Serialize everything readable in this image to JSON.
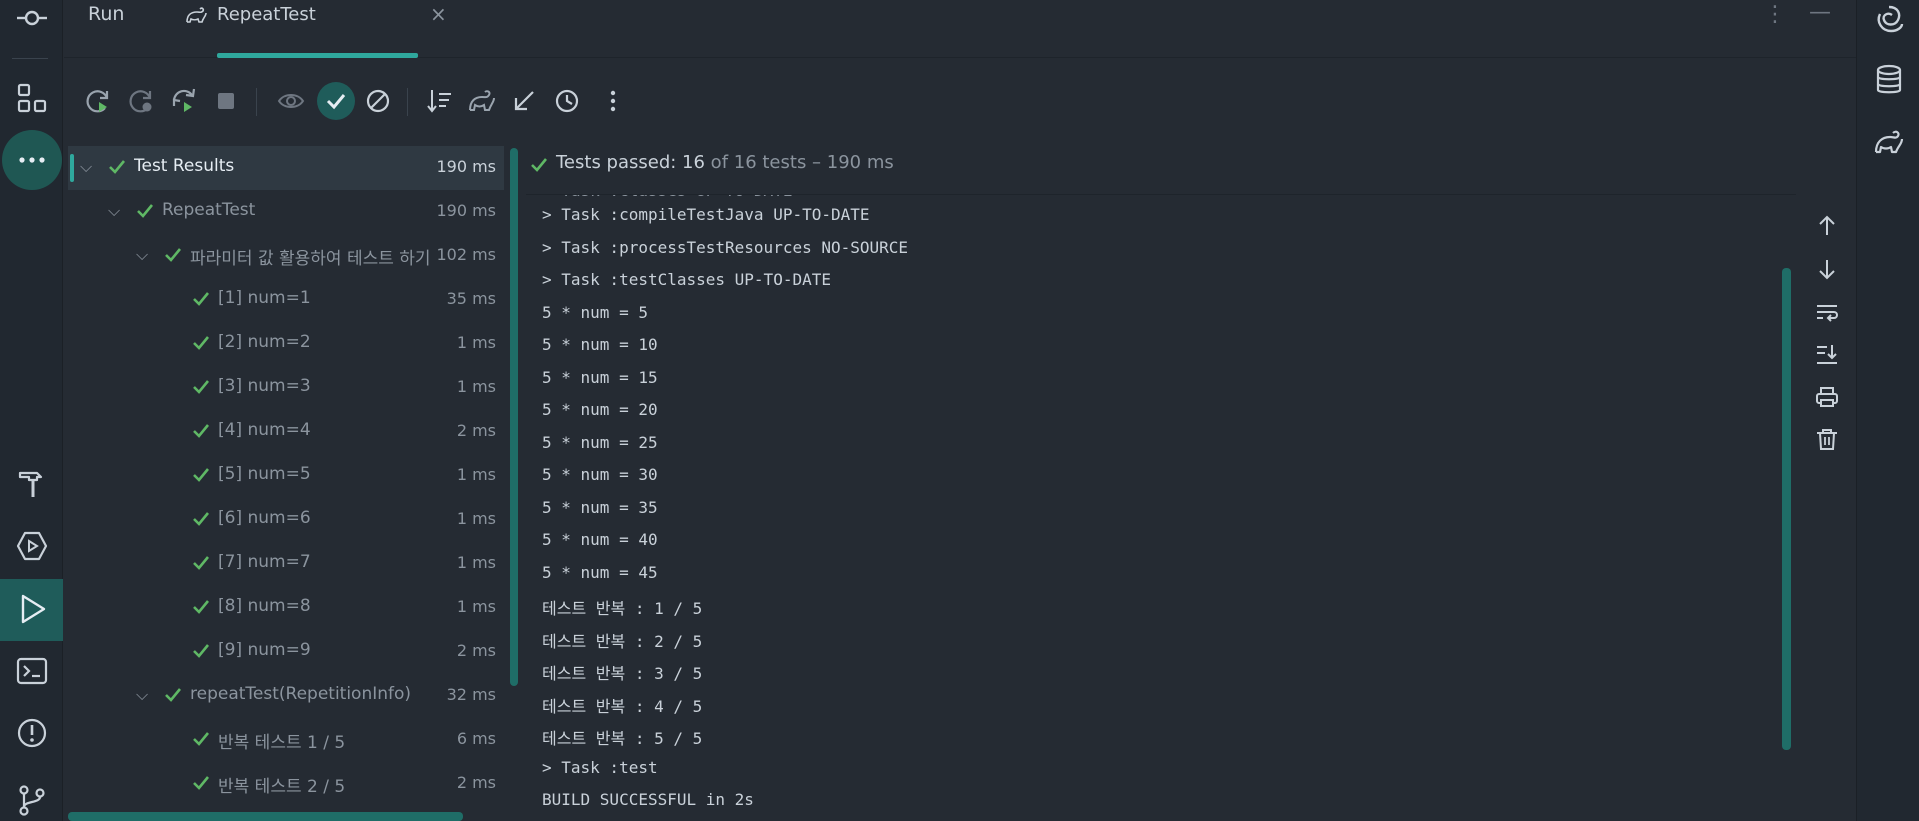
{
  "tabs": {
    "run_label": "Run",
    "repeat_label": "RepeatTest",
    "close_glyph": "×"
  },
  "toolbar": {
    "buttons": [
      "rerun-icon",
      "rerun-failed-icon",
      "toggle-auto-test-icon",
      "stop-icon",
      "show-ignored-icon",
      "show-passed-icon",
      "show-ignored-toggle-icon",
      "sort-icon",
      "import-tests-icon",
      "collapse-icon",
      "history-icon",
      "more-icon"
    ]
  },
  "tree": {
    "root": {
      "label": "Test Results",
      "time": "190 ms"
    },
    "repeat_class": {
      "label": "RepeatTest",
      "time": "190 ms"
    },
    "param_group": {
      "label": "파라미터 값 활용하여 테스트 하기",
      "time": "102 ms"
    },
    "param_items": [
      {
        "label": "[1] num=1",
        "time": "35 ms"
      },
      {
        "label": "[2] num=2",
        "time": "1 ms"
      },
      {
        "label": "[3] num=3",
        "time": "1 ms"
      },
      {
        "label": "[4] num=4",
        "time": "2 ms"
      },
      {
        "label": "[5] num=5",
        "time": "1 ms"
      },
      {
        "label": "[6] num=6",
        "time": "1 ms"
      },
      {
        "label": "[7] num=7",
        "time": "1 ms"
      },
      {
        "label": "[8] num=8",
        "time": "1 ms"
      },
      {
        "label": "[9] num=9",
        "time": "2 ms"
      }
    ],
    "repeat_group": {
      "label": "repeatTest(RepetitionInfo)",
      "time": "32 ms"
    },
    "repeat_items": [
      {
        "label": "반복 테스트 1 / 5",
        "time": "6 ms"
      },
      {
        "label": "반복 테스트 2 / 5",
        "time": "2 ms"
      }
    ]
  },
  "status": {
    "passed": "Tests passed: 16",
    "rest": " of 16 tests – 190 ms"
  },
  "console": {
    "lines": [
      "> Task :compileTestJava UP-TO-DATE",
      "> Task :processTestResources NO-SOURCE",
      "> Task :testClasses UP-TO-DATE",
      "5 * num = 5",
      "5 * num = 10",
      "5 * num = 15",
      "5 * num = 20",
      "5 * num = 25",
      "5 * num = 30",
      "5 * num = 35",
      "5 * num = 40",
      "5 * num = 45",
      "테스트 반복 : 1 / 5",
      "테스트 반복 : 2 / 5",
      "테스트 반복 : 3 / 5",
      "테스트 반복 : 4 / 5",
      "테스트 반복 : 5 / 5",
      "> Task :test",
      "BUILD SUCCESSFUL in 2s"
    ]
  },
  "colors": {
    "accent": "#2fa89d",
    "pass": "#5fb865",
    "background": "#252b33"
  }
}
